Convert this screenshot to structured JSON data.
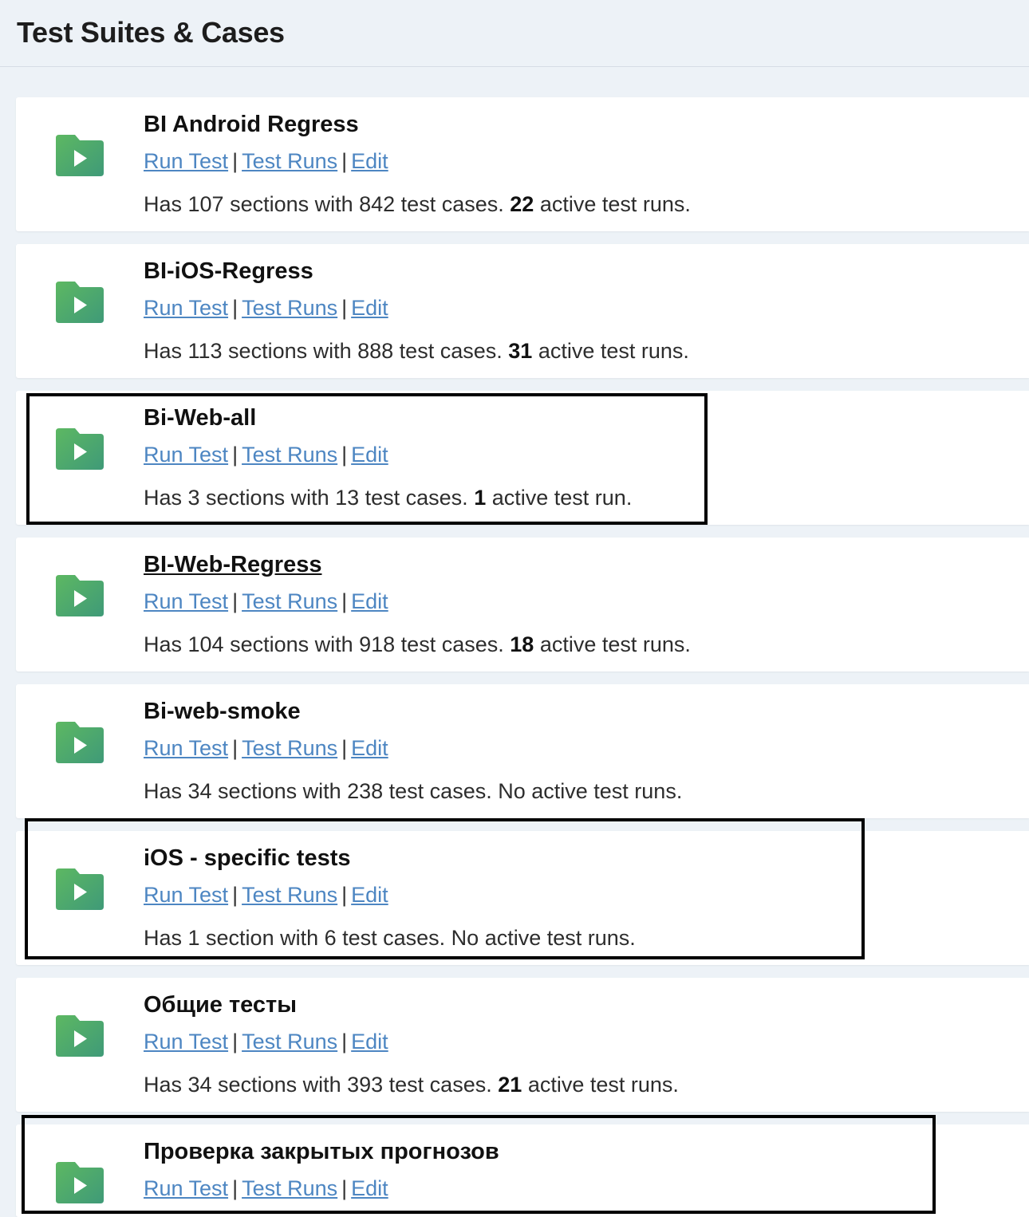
{
  "header": {
    "title": "Test Suites & Cases"
  },
  "links": {
    "run_test": "Run Test",
    "test_runs": "Test Runs",
    "edit": "Edit",
    "separator": "|"
  },
  "suites": [
    {
      "name": "BI Android Regress",
      "desc_prefix": "Has 107 sections with 842 test cases.",
      "active_count": "22",
      "desc_suffix": "active test runs."
    },
    {
      "name": "BI-iOS-Regress",
      "desc_prefix": "Has 113 sections with 888 test cases.",
      "active_count": "31",
      "desc_suffix": "active test runs."
    },
    {
      "name": "Bi-Web-all",
      "desc_prefix": "Has 3 sections with 13 test cases.",
      "active_count": "1",
      "desc_suffix": "active test run."
    },
    {
      "name": "BI-Web-Regress",
      "desc_prefix": "Has 104 sections with 918 test cases.",
      "active_count": "18",
      "desc_suffix": "active test runs."
    },
    {
      "name": "Bi-web-smoke",
      "desc_prefix": "Has 34 sections with 238 test cases. No active test runs.",
      "active_count": "",
      "desc_suffix": ""
    },
    {
      "name": "iOS - specific tests",
      "desc_prefix": "Has 1 section with 6 test cases. No active test runs.",
      "active_count": "",
      "desc_suffix": ""
    },
    {
      "name": "Общие тесты",
      "desc_prefix": "Has 34 sections with 393 test cases.",
      "active_count": "21",
      "desc_suffix": "active test runs."
    },
    {
      "name": "Проверка закрытых прогнозов",
      "desc_prefix": "",
      "active_count": "",
      "desc_suffix": ""
    }
  ],
  "colors": {
    "link": "#4d86c2",
    "folder_top": "#5db862",
    "folder_bottom": "#3f9a78",
    "page_bg": "#edf2f7"
  },
  "icons": {
    "suite_icon": "folder-play-icon"
  }
}
